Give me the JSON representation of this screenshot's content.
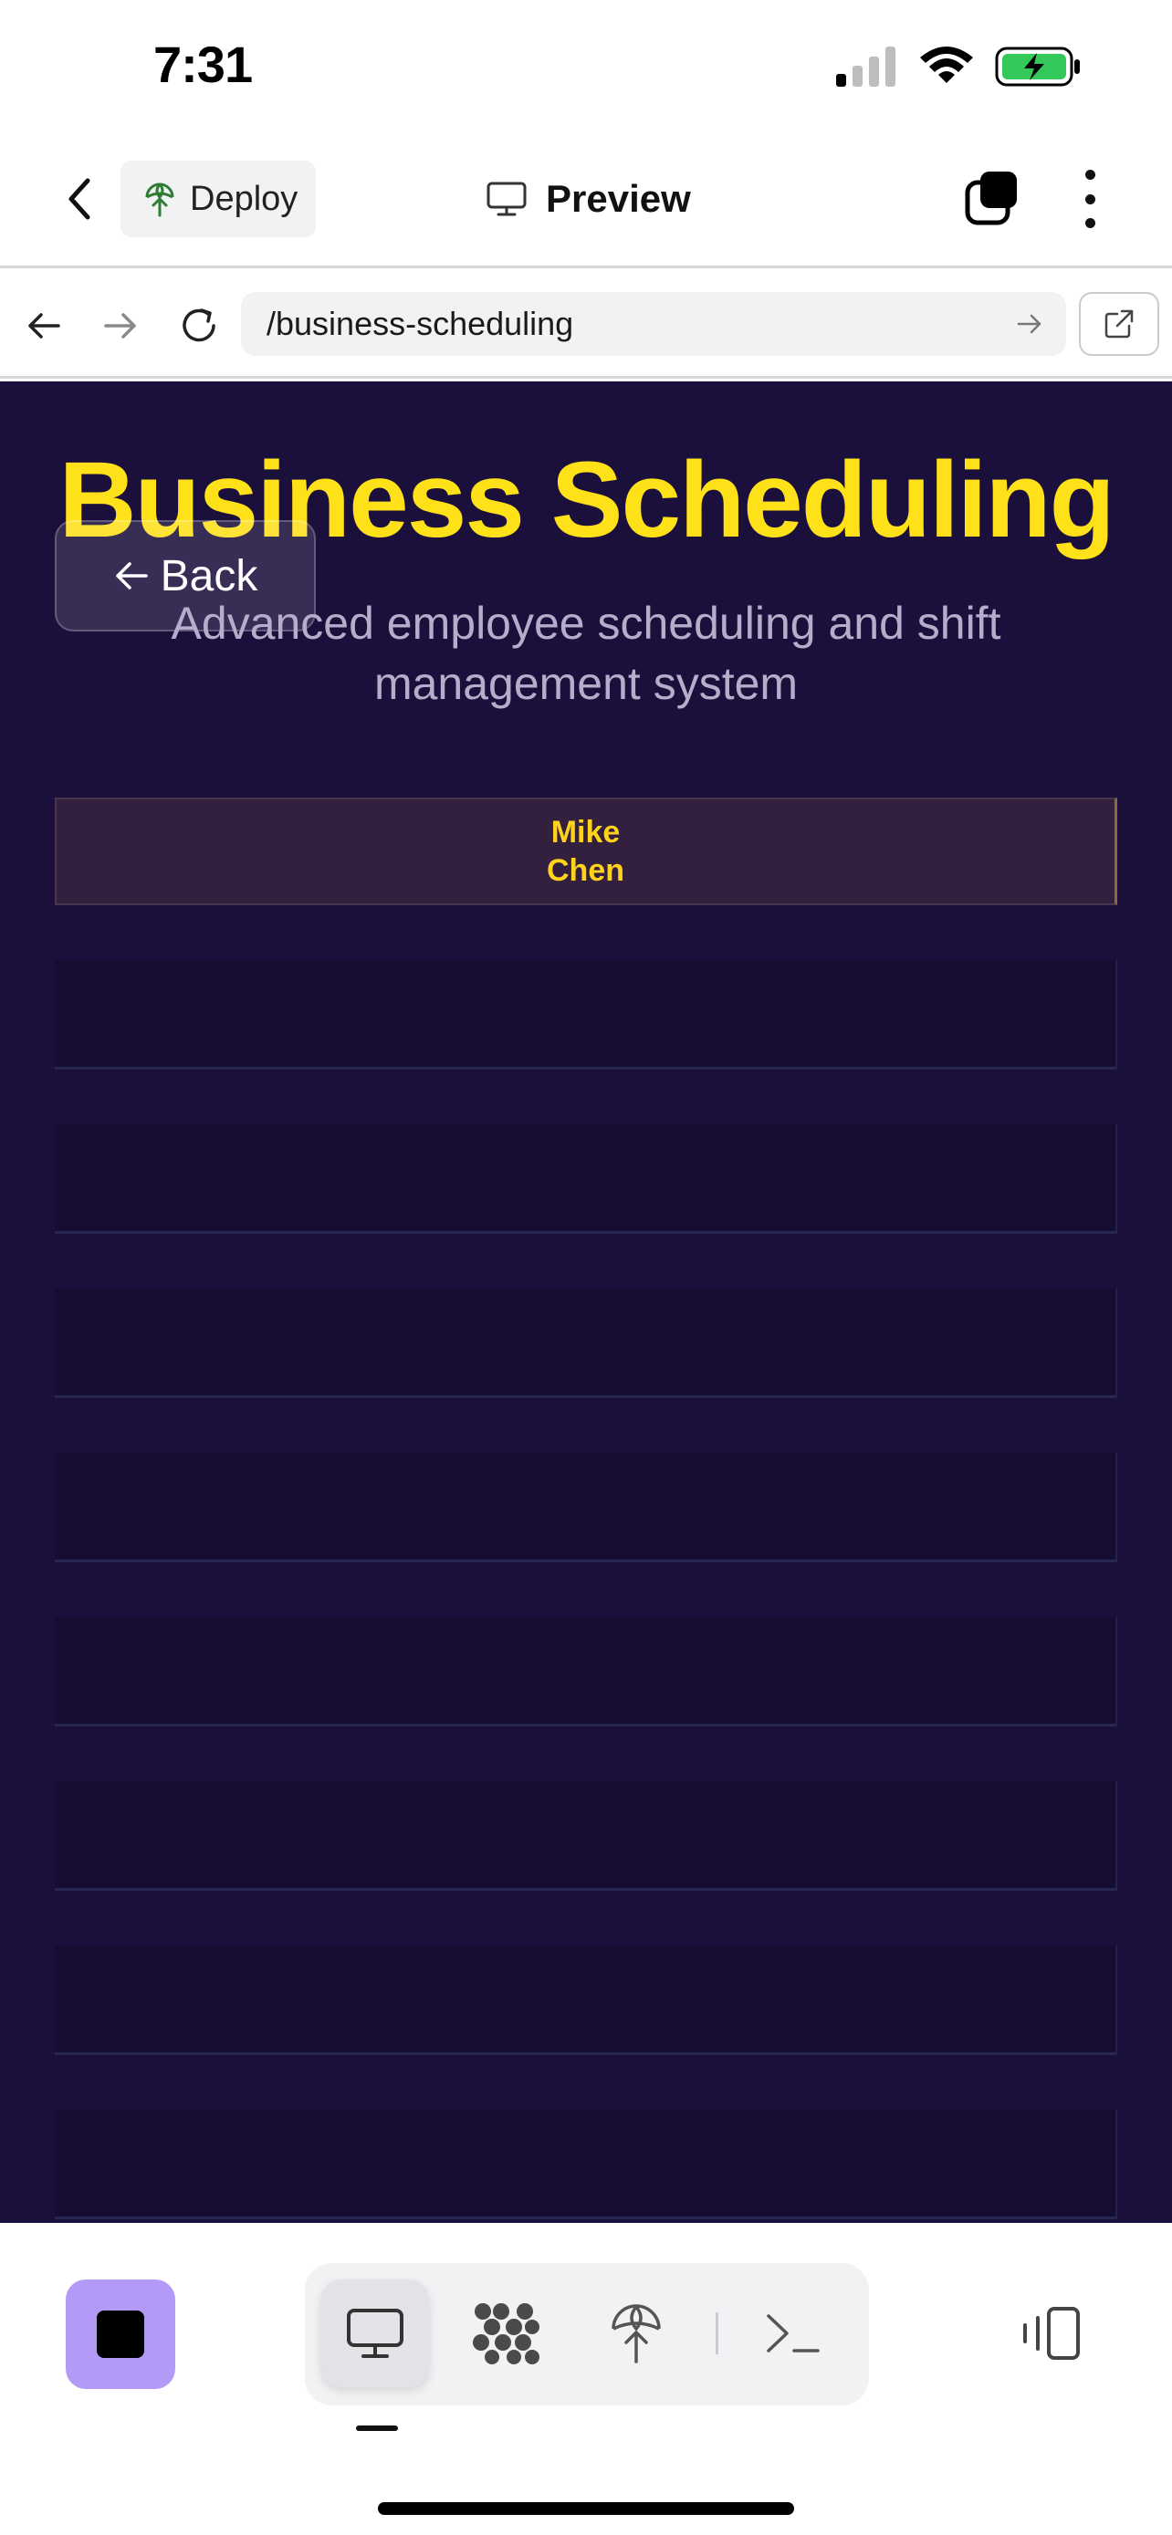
{
  "status_bar": {
    "time": "7:31"
  },
  "header": {
    "deploy_label": "Deploy",
    "preview_label": "Preview"
  },
  "browser": {
    "url": "/business-scheduling"
  },
  "page": {
    "title": "Business Scheduling",
    "subtitle": "Advanced employee scheduling and shift management system",
    "back_label": "Back",
    "employee": {
      "first_name": "Mike",
      "last_name": "Chen"
    },
    "schedule_rows": 8
  },
  "toolbar": {
    "segments": [
      "desktop-icon",
      "apps-icon",
      "deploy-icon",
      "terminal-icon"
    ],
    "active_segment": "desktop-icon"
  },
  "colors": {
    "title": "#ffe11a",
    "background": "#1b0f3c",
    "employee_name": "#ffd31a",
    "stop_button": "#b39af7"
  }
}
